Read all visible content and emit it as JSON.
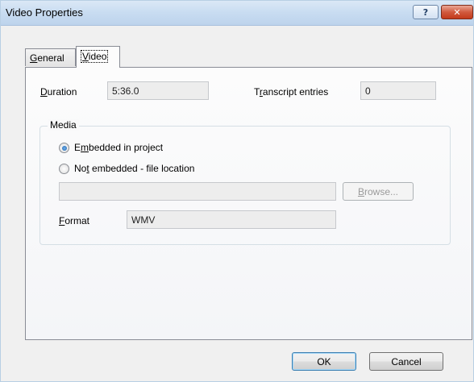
{
  "window": {
    "title": "Video Properties",
    "help_glyph": "?",
    "close_glyph": "✕"
  },
  "tabs": [
    {
      "label_pre": "",
      "label_key": "G",
      "label_post": "eneral"
    },
    {
      "label_pre": "",
      "label_key": "V",
      "label_post": "ideo"
    }
  ],
  "duration": {
    "label_pre": "",
    "label_key": "D",
    "label_post": "uration",
    "value": "5:36.0"
  },
  "transcript": {
    "label_pre": "T",
    "label_key": "r",
    "label_post": "anscript entries",
    "value": "0"
  },
  "media": {
    "legend": "Media",
    "embedded": {
      "label_pre": "E",
      "label_key": "m",
      "label_post": "bedded in project",
      "checked": true
    },
    "not_embedded": {
      "label_pre": "No",
      "label_key": "t",
      "label_post": " embedded - file location",
      "checked": false
    },
    "file_location_value": "",
    "browse": {
      "label_pre": "",
      "label_key": "B",
      "label_post": "rowse..."
    },
    "format": {
      "label_pre": "",
      "label_key": "F",
      "label_post": "ormat",
      "value": "WMV"
    }
  },
  "buttons": {
    "ok": "OK",
    "cancel": "Cancel"
  }
}
